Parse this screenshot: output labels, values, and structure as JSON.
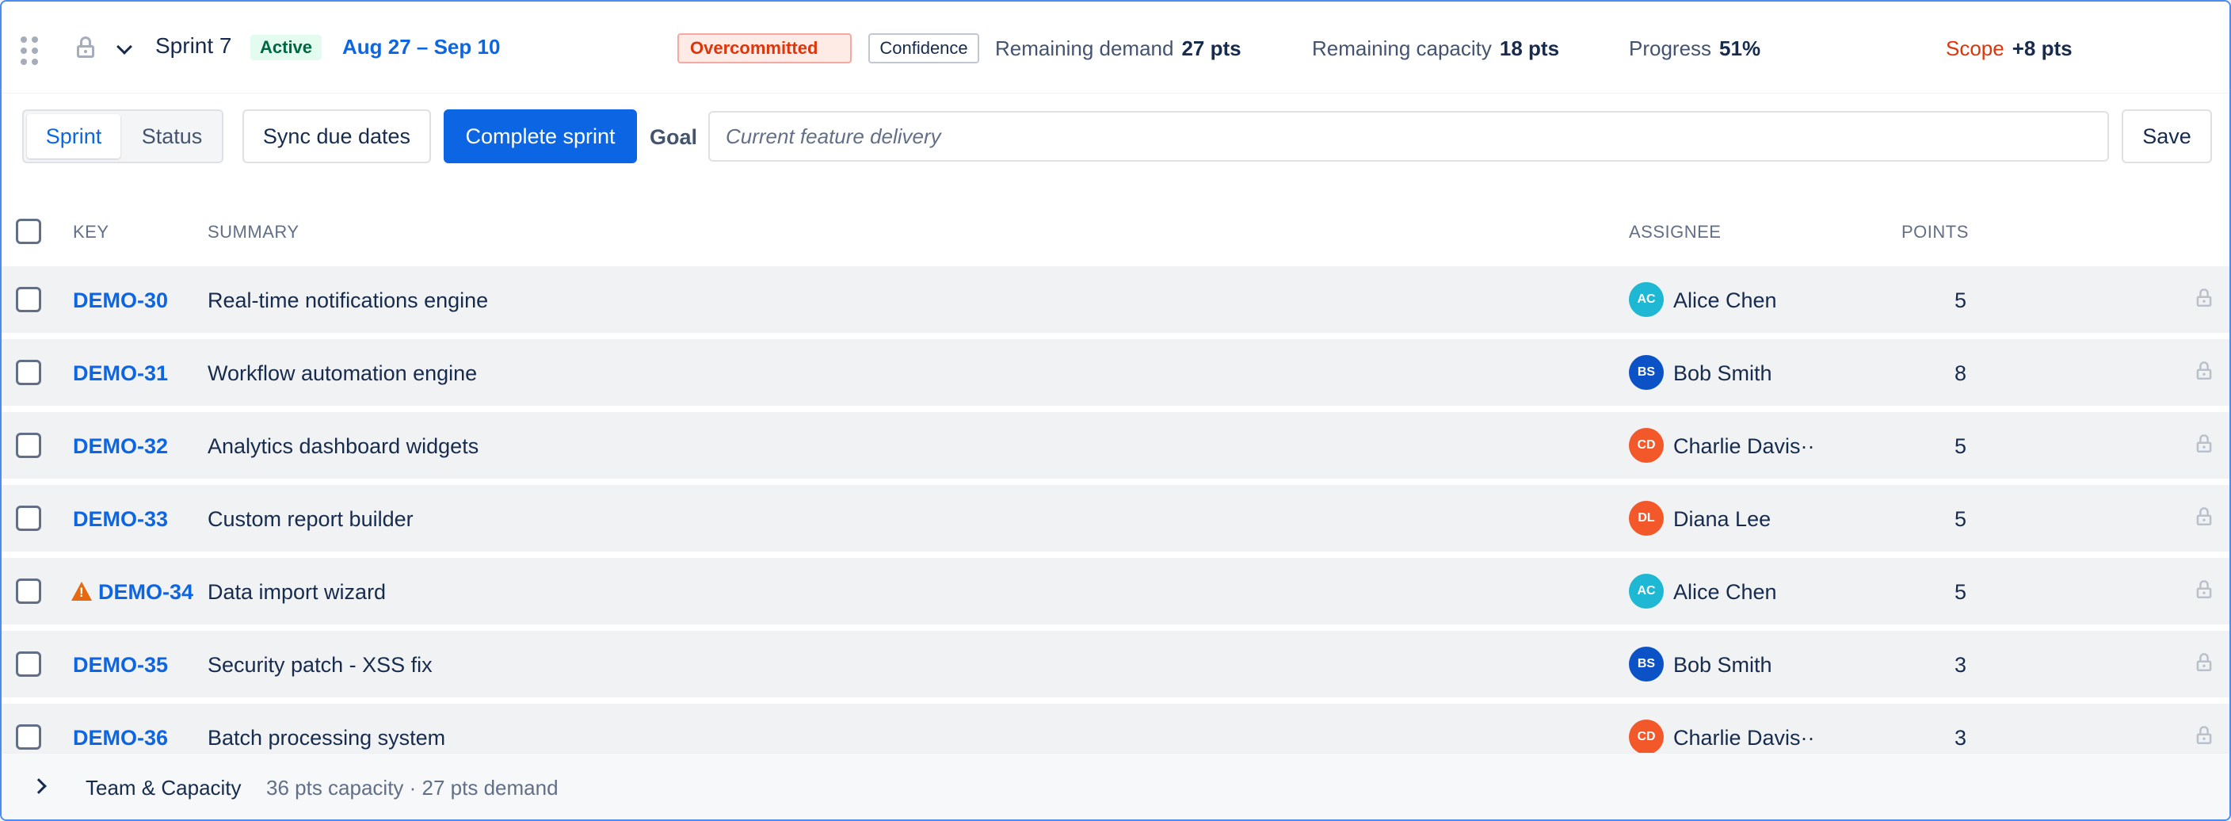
{
  "header": {
    "sprint_name": "Sprint 7",
    "status": "Active",
    "date_range": "Aug 27 – Sep 10",
    "overcommitted_label": "Overcommitted",
    "confidence_label": "Confidence",
    "remaining_demand": {
      "label": "Remaining demand",
      "value": "27 pts"
    },
    "remaining_capacity": {
      "label": "Remaining capacity",
      "value": "18 pts"
    },
    "progress": {
      "label": "Progress",
      "value": "51%"
    },
    "scope": {
      "label": "Scope",
      "value": "+8 pts"
    }
  },
  "toolbar": {
    "view_toggle": {
      "options": [
        "Sprint",
        "Status"
      ],
      "selected": "Sprint"
    },
    "sync_label": "Sync due dates",
    "complete_label": "Complete sprint",
    "goal_label": "Goal",
    "goal_placeholder": "Current feature delivery",
    "save_label": "Save"
  },
  "table": {
    "columns": [
      "KEY",
      "SUMMARY",
      "ASSIGNEE",
      "POINTS"
    ],
    "rows": [
      {
        "key": "DEMO-30",
        "summary": "Real-time notifications engine",
        "initials": "AC",
        "assignee": "Alice Chen",
        "points": "5",
        "avatar_color": "#1fb8d4",
        "warning": false
      },
      {
        "key": "DEMO-31",
        "summary": "Workflow automation engine",
        "initials": "BS",
        "assignee": "Bob Smith",
        "points": "8",
        "avatar_color": "#0c52c7",
        "warning": false
      },
      {
        "key": "DEMO-32",
        "summary": "Analytics dashboard widgets",
        "initials": "CD",
        "assignee": "Charlie Davis··",
        "points": "5",
        "avatar_color": "#f3582b",
        "warning": false
      },
      {
        "key": "DEMO-33",
        "summary": "Custom report builder",
        "initials": "DL",
        "assignee": "Diana Lee",
        "points": "5",
        "avatar_color": "#f3582b",
        "warning": false
      },
      {
        "key": "DEMO-34",
        "summary": "Data import wizard",
        "initials": "AC",
        "assignee": "Alice Chen",
        "points": "5",
        "avatar_color": "#1fb8d4",
        "warning": true
      },
      {
        "key": "DEMO-35",
        "summary": "Security patch - XSS fix",
        "initials": "BS",
        "assignee": "Bob Smith",
        "points": "3",
        "avatar_color": "#0c52c7",
        "warning": false
      },
      {
        "key": "DEMO-36",
        "summary": "Batch processing system",
        "initials": "CD",
        "assignee": "Charlie Davis··",
        "points": "3",
        "avatar_color": "#f3582b",
        "warning": false
      }
    ]
  },
  "footer": {
    "title": "Team & Capacity",
    "meta": "36 pts capacity · 27 pts demand"
  }
}
